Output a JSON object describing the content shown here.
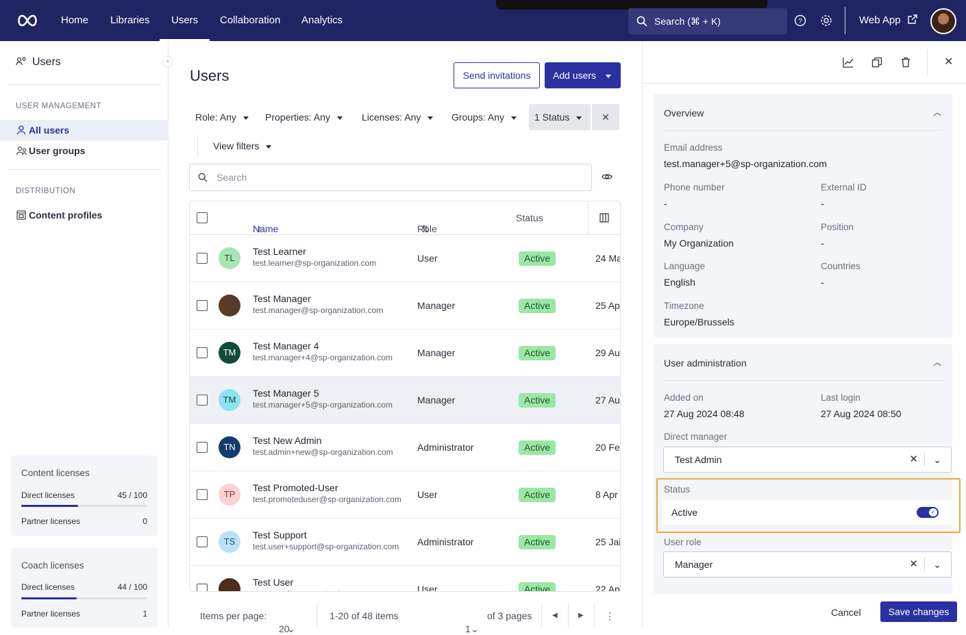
{
  "topnav": {
    "items": [
      "Home",
      "Libraries",
      "Users",
      "Collaboration",
      "Analytics"
    ],
    "active": "Users",
    "search_label": "Search (⌘ + K)",
    "web_app": "Web App"
  },
  "sidebar": {
    "title": "Users",
    "section1": "USER MANAGEMENT",
    "all_users": "All users",
    "user_groups": "User groups",
    "section2": "DISTRIBUTION",
    "content_profiles": "Content profiles",
    "content_licenses": {
      "title": "Content licenses",
      "direct_label": "Direct licenses",
      "direct_value": "45 / 100",
      "direct_fraction": 0.45,
      "partner_label": "Partner licenses",
      "partner_value": "0"
    },
    "coach_licenses": {
      "title": "Coach licenses",
      "direct_label": "Direct licenses",
      "direct_value": "44 / 100",
      "direct_fraction": 0.44,
      "partner_label": "Partner licenses",
      "partner_value": "1"
    }
  },
  "main": {
    "title": "Users",
    "send_invitations": "Send invitations",
    "add_users": "Add users",
    "filters": {
      "role": "Role: Any",
      "properties": "Properties: Any",
      "licenses": "Licenses: Any",
      "groups": "Groups: Any",
      "status": "1 Status",
      "view": "View filters"
    },
    "search_placeholder": "Search",
    "columns": {
      "name": "Name",
      "role": "Role",
      "status": "Status"
    },
    "rows": [
      {
        "initials": "TL",
        "name": "Test Learner",
        "email": "test.learner@sp-organization.com",
        "role": "User",
        "status": "Active",
        "date": "24 Ma",
        "avatar_bg": "#a7e6b4",
        "avatar_fg": "#1d5a2a"
      },
      {
        "initials": "",
        "name": "Test Manager",
        "email": "test.manager@sp-organization.com",
        "role": "Manager",
        "status": "Active",
        "date": "25 Ap",
        "avatar_bg": "#5a3a28",
        "avatar_fg": "#fff"
      },
      {
        "initials": "TM",
        "name": "Test Manager 4",
        "email": "test.manager+4@sp-organization.com",
        "role": "Manager",
        "status": "Active",
        "date": "29 Au",
        "avatar_bg": "#0f4a3a",
        "avatar_fg": "#fff"
      },
      {
        "initials": "TM",
        "name": "Test Manager 5",
        "email": "test.manager+5@sp-organization.com",
        "role": "Manager",
        "status": "Active",
        "date": "27 Au",
        "avatar_bg": "#8be3ee",
        "avatar_fg": "#0d4a52"
      },
      {
        "initials": "TN",
        "name": "Test New Admin",
        "email": "test.admin+new@sp-organization.com",
        "role": "Administrator",
        "status": "Active",
        "date": "20 Fe",
        "avatar_bg": "#123d6b",
        "avatar_fg": "#fff"
      },
      {
        "initials": "TP",
        "name": "Test Promoted-User",
        "email": "test.promoteduser@sp-organization.com",
        "role": "User",
        "status": "Active",
        "date": "8 Apr",
        "avatar_bg": "#fcd2d2",
        "avatar_fg": "#a12b2b"
      },
      {
        "initials": "TS",
        "name": "Test Support",
        "email": "test.user+support@sp-organization.com",
        "role": "Administrator",
        "status": "Active",
        "date": "25 Jai",
        "avatar_bg": "#b9e2f7",
        "avatar_fg": "#17527a"
      },
      {
        "initials": "",
        "name": "Test User",
        "email": "test.user@sp-organization.com",
        "role": "User",
        "status": "Active",
        "date": "22 Ap",
        "avatar_bg": "#4a2e1e",
        "avatar_fg": "#fff"
      }
    ],
    "pager": {
      "items_per_page_label": "Items per page:",
      "items_per_page": "20",
      "range": "1-20 of 48 items",
      "page": "1",
      "of_pages": "of 3 pages"
    }
  },
  "panel": {
    "overview_title": "Overview",
    "email_label": "Email address",
    "email_value": "test.manager+5@sp-organization.com",
    "phone_label": "Phone number",
    "phone_value": "-",
    "external_label": "External ID",
    "external_value": "-",
    "company_label": "Company",
    "company_value": "My Organization",
    "position_label": "Position",
    "position_value": "-",
    "language_label": "Language",
    "language_value": "English",
    "countries_label": "Countries",
    "countries_value": "-",
    "timezone_label": "Timezone",
    "timezone_value": "Europe/Brussels",
    "admin_title": "User administration",
    "added_label": "Added on",
    "added_value": "27 Aug 2024 08:48",
    "login_label": "Last login",
    "login_value": "27 Aug 2024 08:50",
    "manager_label": "Direct manager",
    "manager_value": "Test Admin",
    "status_label": "Status",
    "status_value": "Active",
    "role_label": "User role",
    "role_value": "Manager",
    "cancel": "Cancel",
    "save": "Save changes"
  }
}
